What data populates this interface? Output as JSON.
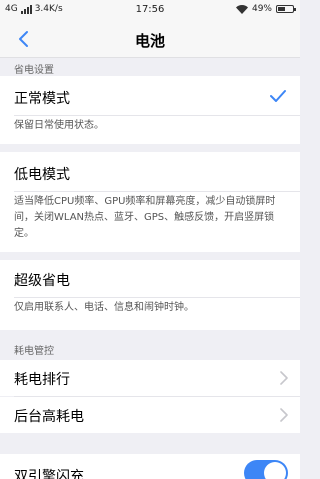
{
  "status": {
    "network": "4G",
    "speed": "3.4K/s",
    "time": "17:56",
    "battery_text": "49%",
    "battery_level": 0.49
  },
  "nav": {
    "title": "电池",
    "back_icon": "chevron-left-icon"
  },
  "section1": {
    "title": "省电设置"
  },
  "modes": [
    {
      "label": "正常模式",
      "desc": "保留日常使用状态。",
      "selected": true
    },
    {
      "label": "低电模式",
      "desc": "适当降低CPU频率、GPU频率和屏幕亮度，减少自动锁屏时间，关闭WLAN热点、蓝牙、GPS、触感反馈，开启竖屏锁定。"
    },
    {
      "label": "超级省电",
      "desc": "仅启用联系人、电话、信息和闹钟时钟。"
    }
  ],
  "section2": {
    "title": "耗电管控"
  },
  "power_items": [
    {
      "label": "耗电排行"
    },
    {
      "label": "后台高耗电"
    }
  ],
  "dual_engine": {
    "label": "双引擎闪充",
    "enabled": true
  },
  "colors": {
    "accent": "#3d86f6",
    "background": "#efeff4"
  }
}
